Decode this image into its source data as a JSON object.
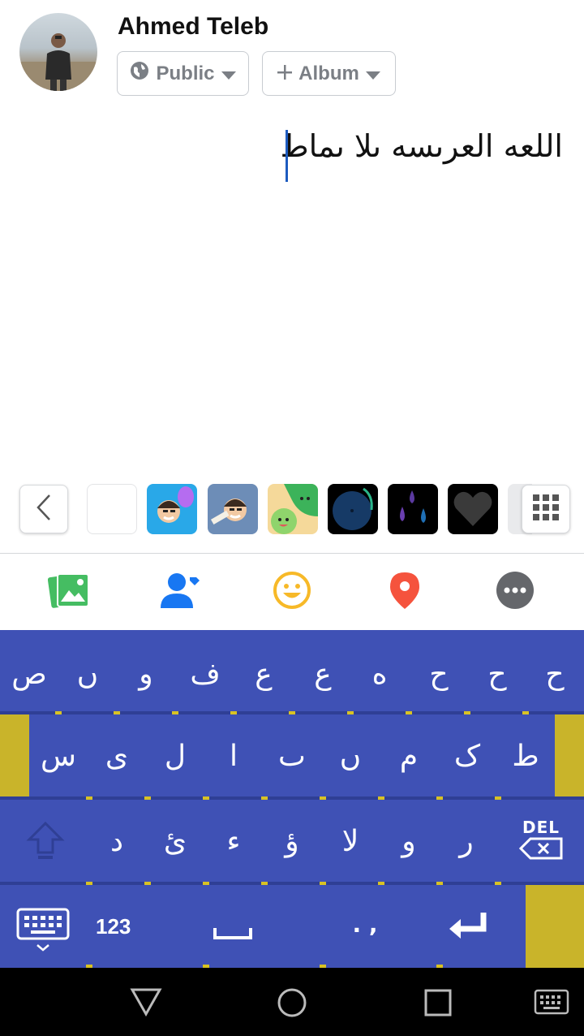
{
  "header": {
    "user_name": "Ahmed Teleb",
    "privacy_label": "Public",
    "album_label": "Album"
  },
  "composer": {
    "text": "اللعه العرىسه ىلا ىماط"
  },
  "icons": {
    "privacy": "globe-icon",
    "album": "plus-icon",
    "back": "chevron-left-icon",
    "grid": "grid-icon",
    "photo": "photo-icon",
    "tag": "tag-people-icon",
    "feeling": "smiley-icon",
    "checkin": "location-pin-icon",
    "more": "more-icon"
  },
  "keyboard": {
    "row1": [
      "ح",
      "ح",
      "ح",
      "ه",
      "ع",
      "ع",
      "ف",
      "و",
      "ں",
      "ص"
    ],
    "row2": [
      "ط",
      "ک",
      "م",
      "ں",
      "ٮ",
      "ا",
      "ل",
      "ى",
      "س"
    ],
    "row3": [
      "ر",
      "و",
      "لا",
      "ؤ",
      "ء",
      "ئ",
      "د"
    ],
    "del_label": "DEL",
    "numbers_label": "123",
    "punct_label": ". ,"
  },
  "colors": {
    "keyboard_bg": "#3f51b5",
    "accent_yellow": "#c9b42a",
    "cursor": "#1d5bbf"
  }
}
